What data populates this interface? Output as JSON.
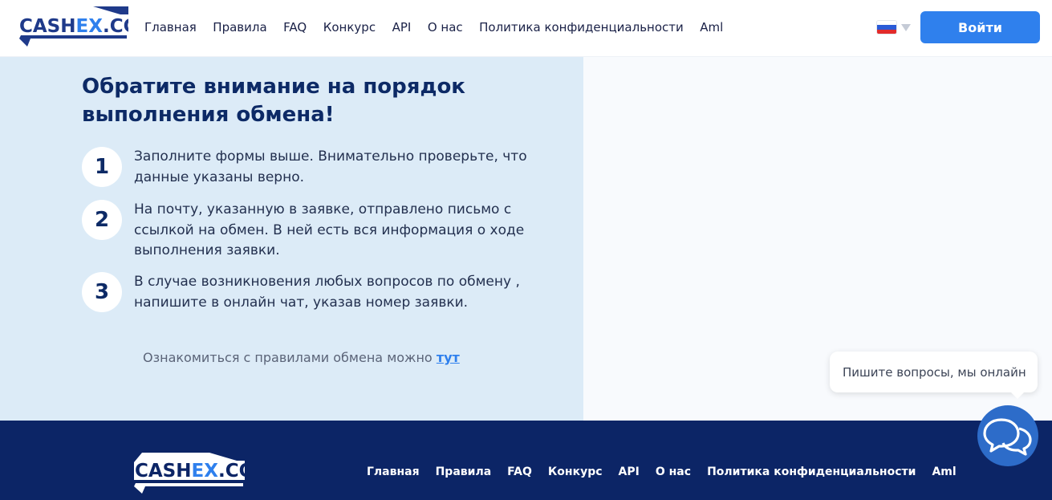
{
  "brand": {
    "logo_text": "CASHEX.CC"
  },
  "nav": {
    "items": [
      "Главная",
      "Правила",
      "FAQ",
      "Конкурс",
      "API",
      "О нас",
      "Политика конфиденциальности",
      "Aml"
    ]
  },
  "header": {
    "login_label": "Войти",
    "language_icon": "flag-ru-icon"
  },
  "info": {
    "title": "Обратите внимание на порядок выполнения обмена!",
    "steps": [
      {
        "number": "1",
        "text": "Заполните формы выше. Внимательно проверьте, что данные указаны верно."
      },
      {
        "number": "2",
        "text": "На почту, указанную в заявке, отправлено письмо с ссылкой на обмен. В ней есть вся информация о ходе выполнения заявки."
      },
      {
        "number": "3",
        "text": "В случае возникновения любых вопросов по обмену , напишите в онлайн чат, указав номер заявки."
      }
    ],
    "rules_note_prefix": "Ознакомиться с правилами обмена можно",
    "rules_link": "тут"
  },
  "footer": {
    "nav_items": [
      "Главная",
      "Правила",
      "FAQ",
      "Конкурс",
      "API",
      "О нас",
      "Политика конфиденциальности",
      "Aml"
    ]
  },
  "chat": {
    "bubble_text": "Пишите вопросы, мы онлайн",
    "icon": "chat-icon"
  },
  "colors": {
    "accent": "#2f80ed",
    "dark_blue": "#0c2566",
    "title_blue": "#0d2a66",
    "panel_bg": "#dcebf7"
  }
}
